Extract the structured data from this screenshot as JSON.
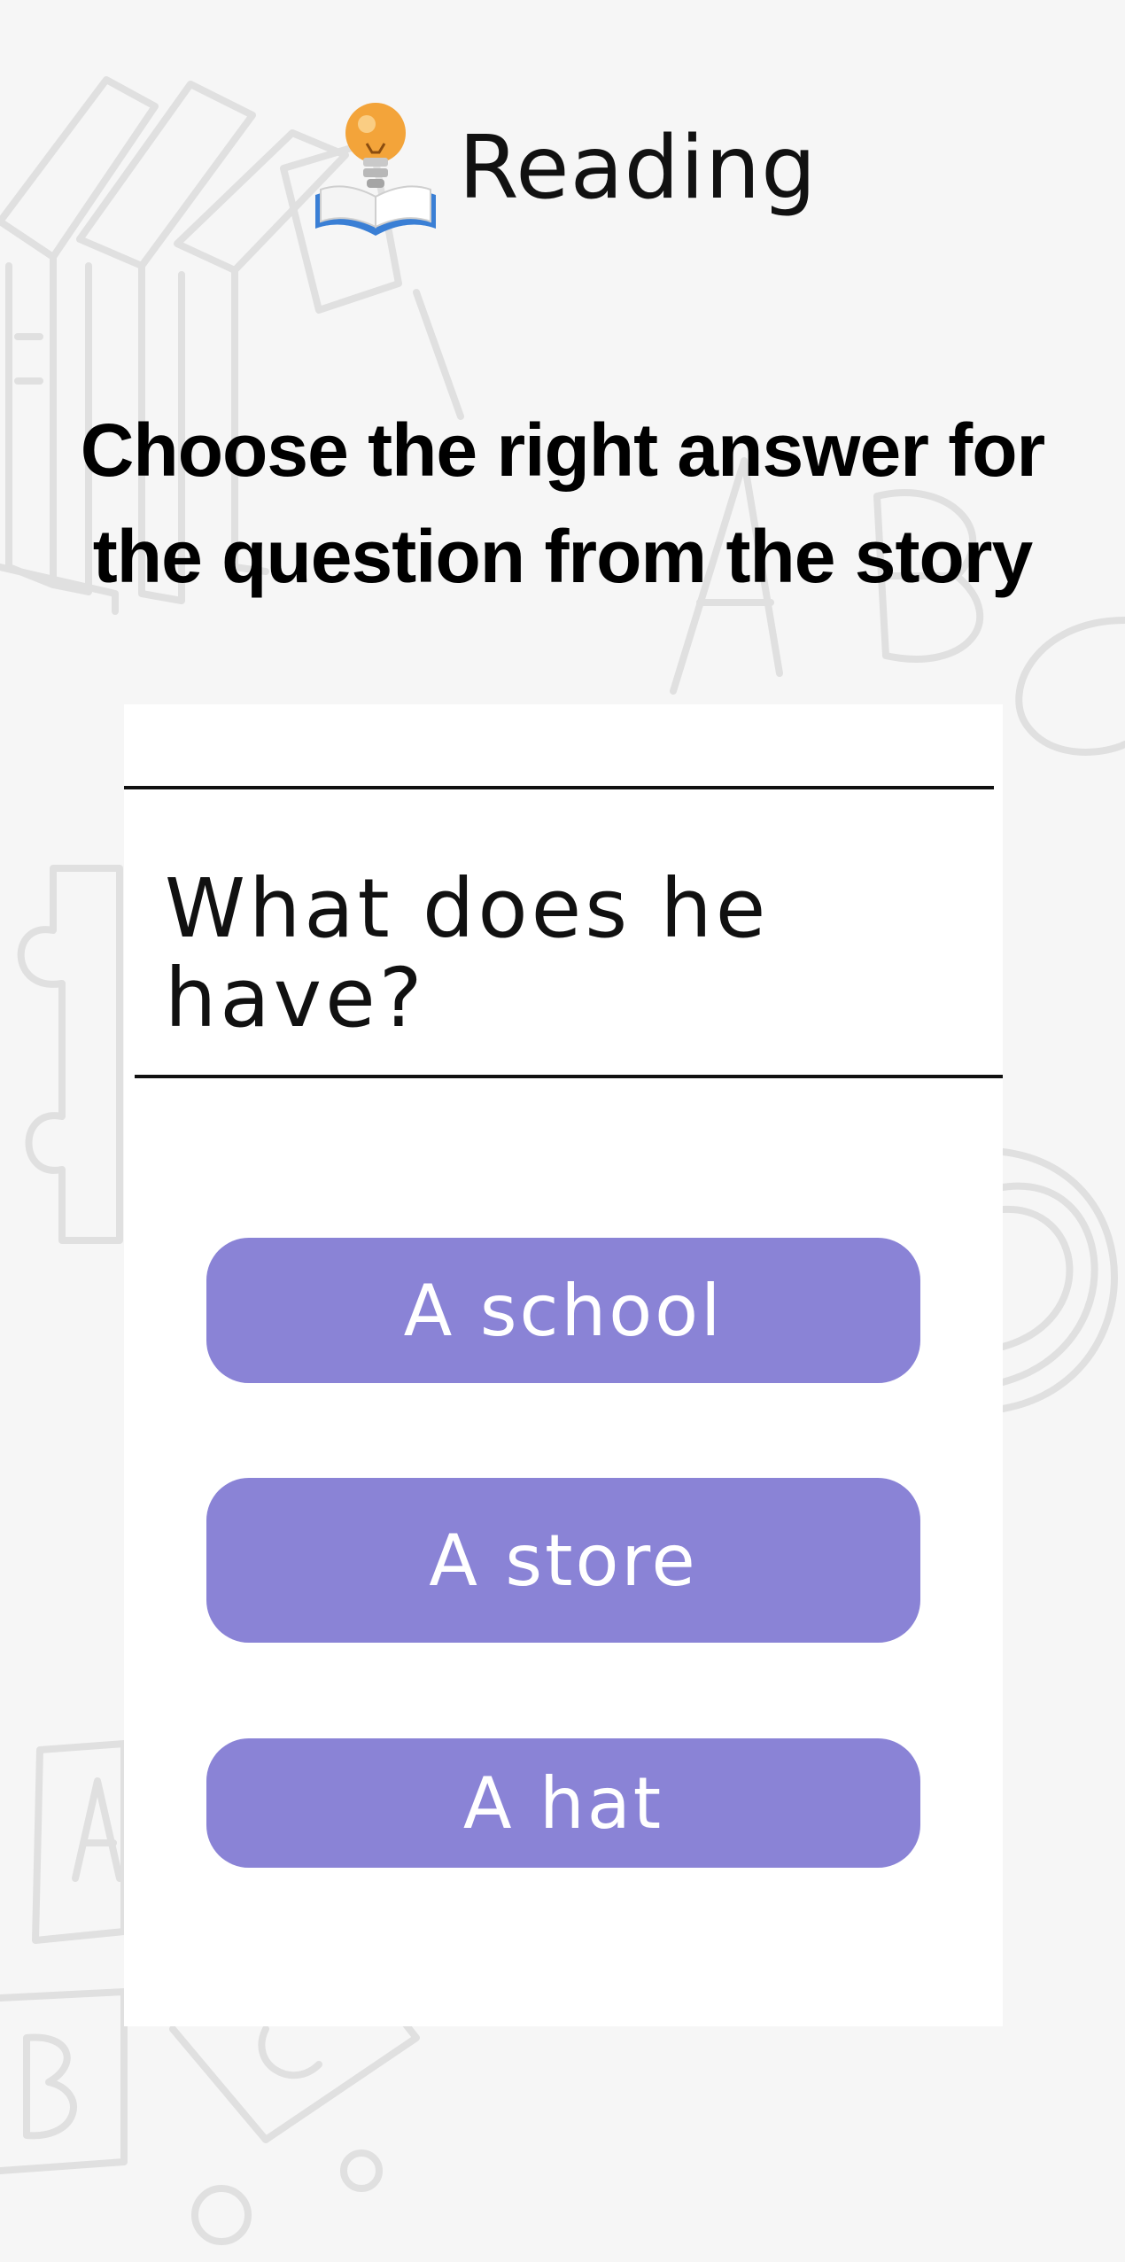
{
  "header": {
    "title": "Reading",
    "icon": "lightbulb-book-icon"
  },
  "instruction": "Choose the right answer for the question from the story",
  "quiz": {
    "question": "What does he have?",
    "answers": [
      {
        "label": "A school"
      },
      {
        "label": "A store"
      },
      {
        "label": "A hat"
      }
    ]
  },
  "colors": {
    "background": "#f6f6f6",
    "card": "#ffffff",
    "answer_button": "#8a83d6",
    "answer_text": "#ffffff",
    "doodle": "#e2e2e2"
  }
}
